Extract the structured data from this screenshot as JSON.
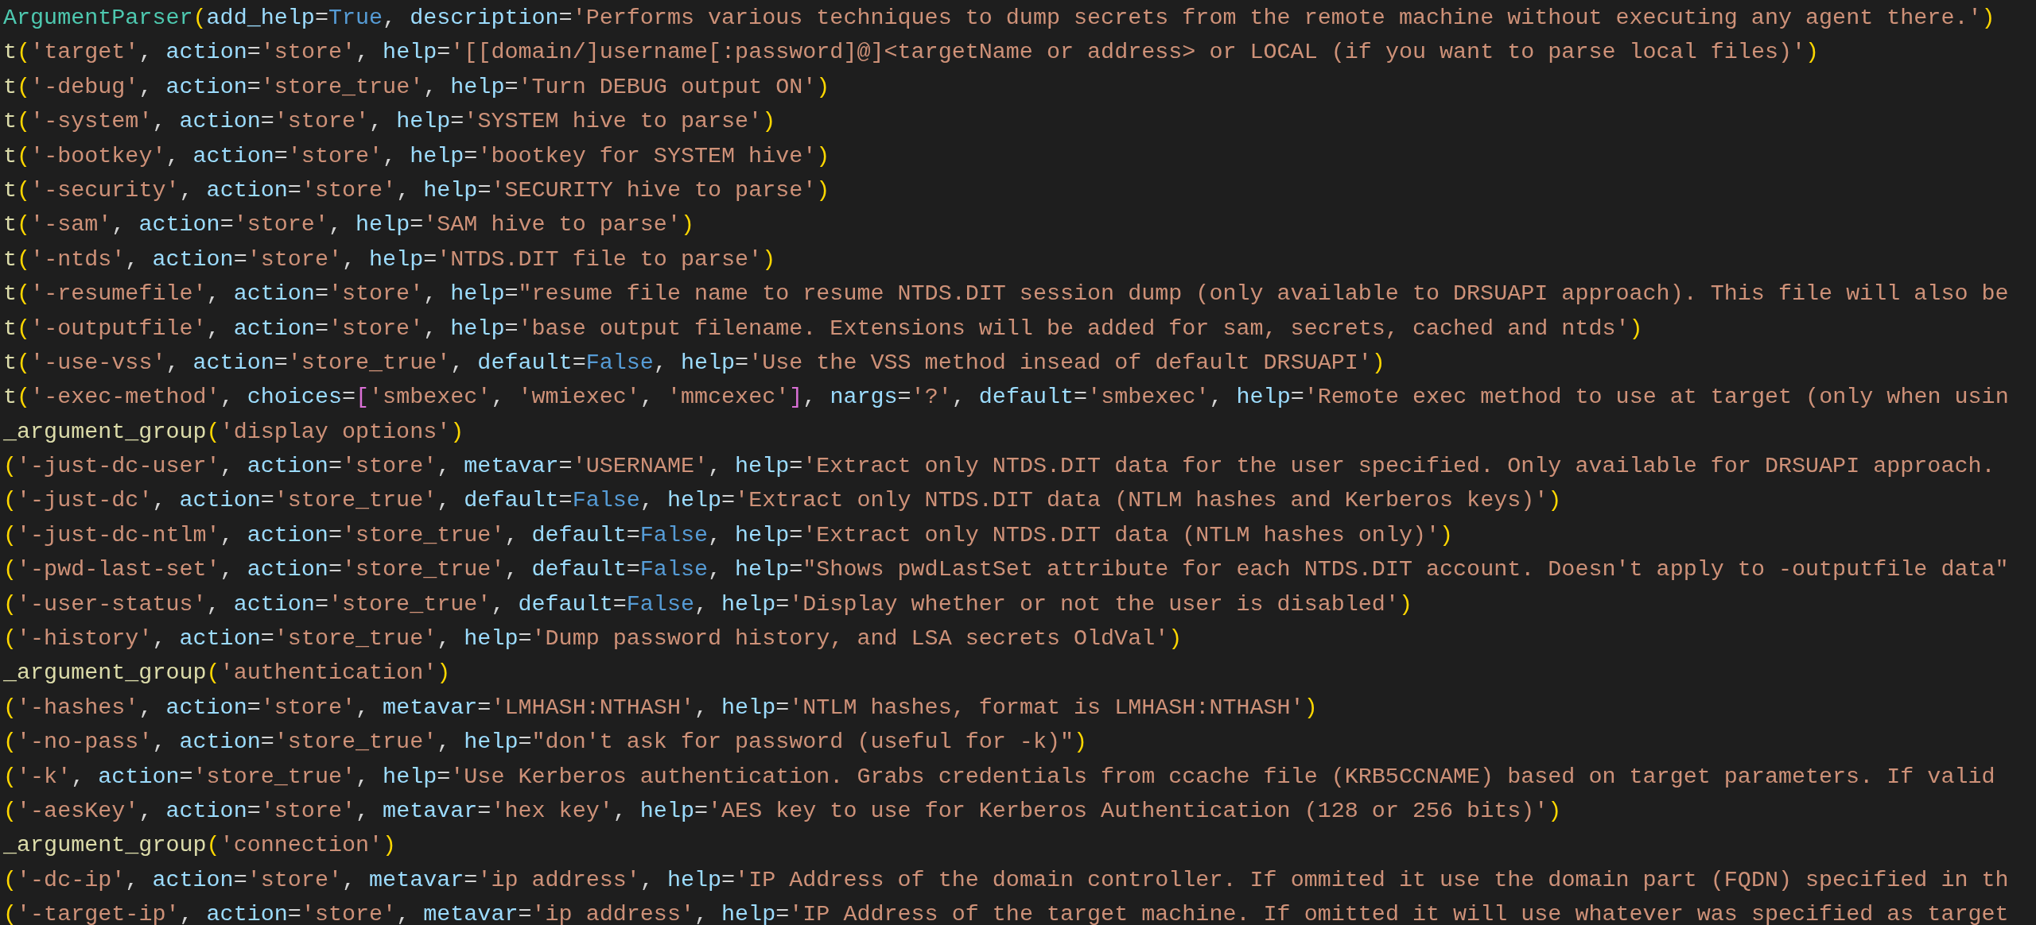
{
  "editor": {
    "lines": [
      {
        "tokens": [
          {
            "kind": "cls",
            "text": "ArgumentParser"
          },
          {
            "kind": "paren",
            "text": "("
          },
          {
            "kind": "arg",
            "text": "add_help"
          },
          {
            "kind": "op",
            "text": "="
          },
          {
            "kind": "kw",
            "text": "True"
          },
          {
            "kind": "op",
            "text": ", "
          },
          {
            "kind": "arg",
            "text": "description"
          },
          {
            "kind": "op",
            "text": "="
          },
          {
            "kind": "str",
            "text": "'Performs various techniques to dump secrets from the remote machine without executing any agent there.'"
          },
          {
            "kind": "paren",
            "text": ")"
          }
        ]
      },
      {
        "tokens": [
          {
            "kind": "fn",
            "text": "t"
          },
          {
            "kind": "paren",
            "text": "("
          },
          {
            "kind": "str",
            "text": "'target'"
          },
          {
            "kind": "op",
            "text": ", "
          },
          {
            "kind": "arg",
            "text": "action"
          },
          {
            "kind": "op",
            "text": "="
          },
          {
            "kind": "str",
            "text": "'store'"
          },
          {
            "kind": "op",
            "text": ", "
          },
          {
            "kind": "arg",
            "text": "help"
          },
          {
            "kind": "op",
            "text": "="
          },
          {
            "kind": "str",
            "text": "'[[domain/]username[:password]@]<targetName or address> or LOCAL (if you want to parse local files)'"
          },
          {
            "kind": "paren",
            "text": ")"
          }
        ]
      },
      {
        "tokens": [
          {
            "kind": "fn",
            "text": "t"
          },
          {
            "kind": "paren",
            "text": "("
          },
          {
            "kind": "str",
            "text": "'-debug'"
          },
          {
            "kind": "op",
            "text": ", "
          },
          {
            "kind": "arg",
            "text": "action"
          },
          {
            "kind": "op",
            "text": "="
          },
          {
            "kind": "str",
            "text": "'store_true'"
          },
          {
            "kind": "op",
            "text": ", "
          },
          {
            "kind": "arg",
            "text": "help"
          },
          {
            "kind": "op",
            "text": "="
          },
          {
            "kind": "str",
            "text": "'Turn DEBUG output ON'"
          },
          {
            "kind": "paren",
            "text": ")"
          }
        ]
      },
      {
        "tokens": [
          {
            "kind": "fn",
            "text": "t"
          },
          {
            "kind": "paren",
            "text": "("
          },
          {
            "kind": "str",
            "text": "'-system'"
          },
          {
            "kind": "op",
            "text": ", "
          },
          {
            "kind": "arg",
            "text": "action"
          },
          {
            "kind": "op",
            "text": "="
          },
          {
            "kind": "str",
            "text": "'store'"
          },
          {
            "kind": "op",
            "text": ", "
          },
          {
            "kind": "arg",
            "text": "help"
          },
          {
            "kind": "op",
            "text": "="
          },
          {
            "kind": "str",
            "text": "'SYSTEM hive to parse'"
          },
          {
            "kind": "paren",
            "text": ")"
          }
        ]
      },
      {
        "tokens": [
          {
            "kind": "fn",
            "text": "t"
          },
          {
            "kind": "paren",
            "text": "("
          },
          {
            "kind": "str",
            "text": "'-bootkey'"
          },
          {
            "kind": "op",
            "text": ", "
          },
          {
            "kind": "arg",
            "text": "action"
          },
          {
            "kind": "op",
            "text": "="
          },
          {
            "kind": "str",
            "text": "'store'"
          },
          {
            "kind": "op",
            "text": ", "
          },
          {
            "kind": "arg",
            "text": "help"
          },
          {
            "kind": "op",
            "text": "="
          },
          {
            "kind": "str",
            "text": "'bootkey for SYSTEM hive'"
          },
          {
            "kind": "paren",
            "text": ")"
          }
        ]
      },
      {
        "tokens": [
          {
            "kind": "fn",
            "text": "t"
          },
          {
            "kind": "paren",
            "text": "("
          },
          {
            "kind": "str",
            "text": "'-security'"
          },
          {
            "kind": "op",
            "text": ", "
          },
          {
            "kind": "arg",
            "text": "action"
          },
          {
            "kind": "op",
            "text": "="
          },
          {
            "kind": "str",
            "text": "'store'"
          },
          {
            "kind": "op",
            "text": ", "
          },
          {
            "kind": "arg",
            "text": "help"
          },
          {
            "kind": "op",
            "text": "="
          },
          {
            "kind": "str",
            "text": "'SECURITY hive to parse'"
          },
          {
            "kind": "paren",
            "text": ")"
          }
        ]
      },
      {
        "tokens": [
          {
            "kind": "fn",
            "text": "t"
          },
          {
            "kind": "paren",
            "text": "("
          },
          {
            "kind": "str",
            "text": "'-sam'"
          },
          {
            "kind": "op",
            "text": ", "
          },
          {
            "kind": "arg",
            "text": "action"
          },
          {
            "kind": "op",
            "text": "="
          },
          {
            "kind": "str",
            "text": "'store'"
          },
          {
            "kind": "op",
            "text": ", "
          },
          {
            "kind": "arg",
            "text": "help"
          },
          {
            "kind": "op",
            "text": "="
          },
          {
            "kind": "str",
            "text": "'SAM hive to parse'"
          },
          {
            "kind": "paren",
            "text": ")"
          }
        ]
      },
      {
        "tokens": [
          {
            "kind": "fn",
            "text": "t"
          },
          {
            "kind": "paren",
            "text": "("
          },
          {
            "kind": "str",
            "text": "'-ntds'"
          },
          {
            "kind": "op",
            "text": ", "
          },
          {
            "kind": "arg",
            "text": "action"
          },
          {
            "kind": "op",
            "text": "="
          },
          {
            "kind": "str",
            "text": "'store'"
          },
          {
            "kind": "op",
            "text": ", "
          },
          {
            "kind": "arg",
            "text": "help"
          },
          {
            "kind": "op",
            "text": "="
          },
          {
            "kind": "str",
            "text": "'NTDS.DIT file to parse'"
          },
          {
            "kind": "paren",
            "text": ")"
          }
        ]
      },
      {
        "tokens": [
          {
            "kind": "fn",
            "text": "t"
          },
          {
            "kind": "paren",
            "text": "("
          },
          {
            "kind": "str",
            "text": "'-resumefile'"
          },
          {
            "kind": "op",
            "text": ", "
          },
          {
            "kind": "arg",
            "text": "action"
          },
          {
            "kind": "op",
            "text": "="
          },
          {
            "kind": "str",
            "text": "'store'"
          },
          {
            "kind": "op",
            "text": ", "
          },
          {
            "kind": "arg",
            "text": "help"
          },
          {
            "kind": "op",
            "text": "="
          },
          {
            "kind": "str",
            "text": "\"resume file name to resume NTDS.DIT session dump (only available to DRSUAPI approach). This file will also be"
          }
        ]
      },
      {
        "tokens": [
          {
            "kind": "fn",
            "text": "t"
          },
          {
            "kind": "paren",
            "text": "("
          },
          {
            "kind": "str",
            "text": "'-outputfile'"
          },
          {
            "kind": "op",
            "text": ", "
          },
          {
            "kind": "arg",
            "text": "action"
          },
          {
            "kind": "op",
            "text": "="
          },
          {
            "kind": "str",
            "text": "'store'"
          },
          {
            "kind": "op",
            "text": ", "
          },
          {
            "kind": "arg",
            "text": "help"
          },
          {
            "kind": "op",
            "text": "="
          },
          {
            "kind": "str",
            "text": "'base output filename. Extensions will be added for sam, secrets, cached and ntds'"
          },
          {
            "kind": "paren",
            "text": ")"
          }
        ]
      },
      {
        "tokens": [
          {
            "kind": "fn",
            "text": "t"
          },
          {
            "kind": "paren",
            "text": "("
          },
          {
            "kind": "str",
            "text": "'-use-vss'"
          },
          {
            "kind": "op",
            "text": ", "
          },
          {
            "kind": "arg",
            "text": "action"
          },
          {
            "kind": "op",
            "text": "="
          },
          {
            "kind": "str",
            "text": "'store_true'"
          },
          {
            "kind": "op",
            "text": ", "
          },
          {
            "kind": "arg",
            "text": "default"
          },
          {
            "kind": "op",
            "text": "="
          },
          {
            "kind": "kw",
            "text": "False"
          },
          {
            "kind": "op",
            "text": ", "
          },
          {
            "kind": "arg",
            "text": "help"
          },
          {
            "kind": "op",
            "text": "="
          },
          {
            "kind": "str",
            "text": "'Use the VSS method insead of default DRSUAPI'"
          },
          {
            "kind": "paren",
            "text": ")"
          }
        ]
      },
      {
        "tokens": [
          {
            "kind": "fn",
            "text": "t"
          },
          {
            "kind": "paren",
            "text": "("
          },
          {
            "kind": "str",
            "text": "'-exec-method'"
          },
          {
            "kind": "op",
            "text": ", "
          },
          {
            "kind": "arg",
            "text": "choices"
          },
          {
            "kind": "op",
            "text": "="
          },
          {
            "kind": "brk",
            "text": "["
          },
          {
            "kind": "str",
            "text": "'smbexec'"
          },
          {
            "kind": "op",
            "text": ", "
          },
          {
            "kind": "str",
            "text": "'wmiexec'"
          },
          {
            "kind": "op",
            "text": ", "
          },
          {
            "kind": "str",
            "text": "'mmcexec'"
          },
          {
            "kind": "brk",
            "text": "]"
          },
          {
            "kind": "op",
            "text": ", "
          },
          {
            "kind": "arg",
            "text": "nargs"
          },
          {
            "kind": "op",
            "text": "="
          },
          {
            "kind": "str",
            "text": "'?'"
          },
          {
            "kind": "op",
            "text": ", "
          },
          {
            "kind": "arg",
            "text": "default"
          },
          {
            "kind": "op",
            "text": "="
          },
          {
            "kind": "str",
            "text": "'smbexec'"
          },
          {
            "kind": "op",
            "text": ", "
          },
          {
            "kind": "arg",
            "text": "help"
          },
          {
            "kind": "op",
            "text": "="
          },
          {
            "kind": "str",
            "text": "'Remote exec method to use at target (only when usin"
          }
        ]
      },
      {
        "tokens": [
          {
            "kind": "fn",
            "text": "_argument_group"
          },
          {
            "kind": "paren",
            "text": "("
          },
          {
            "kind": "str",
            "text": "'display options'"
          },
          {
            "kind": "paren",
            "text": ")"
          }
        ]
      },
      {
        "tokens": [
          {
            "kind": "paren",
            "text": "("
          },
          {
            "kind": "str",
            "text": "'-just-dc-user'"
          },
          {
            "kind": "op",
            "text": ", "
          },
          {
            "kind": "arg",
            "text": "action"
          },
          {
            "kind": "op",
            "text": "="
          },
          {
            "kind": "str",
            "text": "'store'"
          },
          {
            "kind": "op",
            "text": ", "
          },
          {
            "kind": "arg",
            "text": "metavar"
          },
          {
            "kind": "op",
            "text": "="
          },
          {
            "kind": "str",
            "text": "'USERNAME'"
          },
          {
            "kind": "op",
            "text": ", "
          },
          {
            "kind": "arg",
            "text": "help"
          },
          {
            "kind": "op",
            "text": "="
          },
          {
            "kind": "str",
            "text": "'Extract only NTDS.DIT data for the user specified. Only available for DRSUAPI approach."
          }
        ]
      },
      {
        "tokens": [
          {
            "kind": "paren",
            "text": "("
          },
          {
            "kind": "str",
            "text": "'-just-dc'"
          },
          {
            "kind": "op",
            "text": ", "
          },
          {
            "kind": "arg",
            "text": "action"
          },
          {
            "kind": "op",
            "text": "="
          },
          {
            "kind": "str",
            "text": "'store_true'"
          },
          {
            "kind": "op",
            "text": ", "
          },
          {
            "kind": "arg",
            "text": "default"
          },
          {
            "kind": "op",
            "text": "="
          },
          {
            "kind": "kw",
            "text": "False"
          },
          {
            "kind": "op",
            "text": ", "
          },
          {
            "kind": "arg",
            "text": "help"
          },
          {
            "kind": "op",
            "text": "="
          },
          {
            "kind": "str",
            "text": "'Extract only NTDS.DIT data (NTLM hashes and Kerberos keys)'"
          },
          {
            "kind": "paren",
            "text": ")"
          }
        ]
      },
      {
        "tokens": [
          {
            "kind": "paren",
            "text": "("
          },
          {
            "kind": "str",
            "text": "'-just-dc-ntlm'"
          },
          {
            "kind": "op",
            "text": ", "
          },
          {
            "kind": "arg",
            "text": "action"
          },
          {
            "kind": "op",
            "text": "="
          },
          {
            "kind": "str",
            "text": "'store_true'"
          },
          {
            "kind": "op",
            "text": ", "
          },
          {
            "kind": "arg",
            "text": "default"
          },
          {
            "kind": "op",
            "text": "="
          },
          {
            "kind": "kw",
            "text": "False"
          },
          {
            "kind": "op",
            "text": ", "
          },
          {
            "kind": "arg",
            "text": "help"
          },
          {
            "kind": "op",
            "text": "="
          },
          {
            "kind": "str",
            "text": "'Extract only NTDS.DIT data (NTLM hashes only)'"
          },
          {
            "kind": "paren",
            "text": ")"
          }
        ]
      },
      {
        "tokens": [
          {
            "kind": "paren",
            "text": "("
          },
          {
            "kind": "str",
            "text": "'-pwd-last-set'"
          },
          {
            "kind": "op",
            "text": ", "
          },
          {
            "kind": "arg",
            "text": "action"
          },
          {
            "kind": "op",
            "text": "="
          },
          {
            "kind": "str",
            "text": "'store_true'"
          },
          {
            "kind": "op",
            "text": ", "
          },
          {
            "kind": "arg",
            "text": "default"
          },
          {
            "kind": "op",
            "text": "="
          },
          {
            "kind": "kw",
            "text": "False"
          },
          {
            "kind": "op",
            "text": ", "
          },
          {
            "kind": "arg",
            "text": "help"
          },
          {
            "kind": "op",
            "text": "="
          },
          {
            "kind": "str",
            "text": "\"Shows pwdLastSet attribute for each NTDS.DIT account. Doesn't apply to -outputfile data\""
          }
        ]
      },
      {
        "tokens": [
          {
            "kind": "paren",
            "text": "("
          },
          {
            "kind": "str",
            "text": "'-user-status'"
          },
          {
            "kind": "op",
            "text": ", "
          },
          {
            "kind": "arg",
            "text": "action"
          },
          {
            "kind": "op",
            "text": "="
          },
          {
            "kind": "str",
            "text": "'store_true'"
          },
          {
            "kind": "op",
            "text": ", "
          },
          {
            "kind": "arg",
            "text": "default"
          },
          {
            "kind": "op",
            "text": "="
          },
          {
            "kind": "kw",
            "text": "False"
          },
          {
            "kind": "op",
            "text": ", "
          },
          {
            "kind": "arg",
            "text": "help"
          },
          {
            "kind": "op",
            "text": "="
          },
          {
            "kind": "str",
            "text": "'Display whether or not the user is disabled'"
          },
          {
            "kind": "paren",
            "text": ")"
          }
        ]
      },
      {
        "tokens": [
          {
            "kind": "paren",
            "text": "("
          },
          {
            "kind": "str",
            "text": "'-history'"
          },
          {
            "kind": "op",
            "text": ", "
          },
          {
            "kind": "arg",
            "text": "action"
          },
          {
            "kind": "op",
            "text": "="
          },
          {
            "kind": "str",
            "text": "'store_true'"
          },
          {
            "kind": "op",
            "text": ", "
          },
          {
            "kind": "arg",
            "text": "help"
          },
          {
            "kind": "op",
            "text": "="
          },
          {
            "kind": "str",
            "text": "'Dump password history, and LSA secrets OldVal'"
          },
          {
            "kind": "paren",
            "text": ")"
          }
        ]
      },
      {
        "tokens": [
          {
            "kind": "fn",
            "text": "_argument_group"
          },
          {
            "kind": "paren",
            "text": "("
          },
          {
            "kind": "str",
            "text": "'authentication'"
          },
          {
            "kind": "paren",
            "text": ")"
          }
        ]
      },
      {
        "tokens": [
          {
            "kind": "paren",
            "text": "("
          },
          {
            "kind": "str",
            "text": "'-hashes'"
          },
          {
            "kind": "op",
            "text": ", "
          },
          {
            "kind": "arg",
            "text": "action"
          },
          {
            "kind": "op",
            "text": "="
          },
          {
            "kind": "str",
            "text": "'store'"
          },
          {
            "kind": "op",
            "text": ", "
          },
          {
            "kind": "arg",
            "text": "metavar"
          },
          {
            "kind": "op",
            "text": "="
          },
          {
            "kind": "str",
            "text": "'LMHASH:NTHASH'"
          },
          {
            "kind": "op",
            "text": ", "
          },
          {
            "kind": "arg",
            "text": "help"
          },
          {
            "kind": "op",
            "text": "="
          },
          {
            "kind": "str",
            "text": "'NTLM hashes, format is LMHASH:NTHASH'"
          },
          {
            "kind": "paren",
            "text": ")"
          }
        ]
      },
      {
        "tokens": [
          {
            "kind": "paren",
            "text": "("
          },
          {
            "kind": "str",
            "text": "'-no-pass'"
          },
          {
            "kind": "op",
            "text": ", "
          },
          {
            "kind": "arg",
            "text": "action"
          },
          {
            "kind": "op",
            "text": "="
          },
          {
            "kind": "str",
            "text": "'store_true'"
          },
          {
            "kind": "op",
            "text": ", "
          },
          {
            "kind": "arg",
            "text": "help"
          },
          {
            "kind": "op",
            "text": "="
          },
          {
            "kind": "str",
            "text": "\"don't ask for password (useful for -k)\""
          },
          {
            "kind": "paren",
            "text": ")"
          }
        ]
      },
      {
        "tokens": [
          {
            "kind": "paren",
            "text": "("
          },
          {
            "kind": "str",
            "text": "'-k'"
          },
          {
            "kind": "op",
            "text": ", "
          },
          {
            "kind": "arg",
            "text": "action"
          },
          {
            "kind": "op",
            "text": "="
          },
          {
            "kind": "str",
            "text": "'store_true'"
          },
          {
            "kind": "op",
            "text": ", "
          },
          {
            "kind": "arg",
            "text": "help"
          },
          {
            "kind": "op",
            "text": "="
          },
          {
            "kind": "str",
            "text": "'Use Kerberos authentication. Grabs credentials from ccache file (KRB5CCNAME) based on target parameters. If valid"
          }
        ]
      },
      {
        "tokens": [
          {
            "kind": "paren",
            "text": "("
          },
          {
            "kind": "str",
            "text": "'-aesKey'"
          },
          {
            "kind": "op",
            "text": ", "
          },
          {
            "kind": "arg",
            "text": "action"
          },
          {
            "kind": "op",
            "text": "="
          },
          {
            "kind": "str",
            "text": "'store'"
          },
          {
            "kind": "op",
            "text": ", "
          },
          {
            "kind": "arg",
            "text": "metavar"
          },
          {
            "kind": "op",
            "text": "="
          },
          {
            "kind": "str",
            "text": "'hex key'"
          },
          {
            "kind": "op",
            "text": ", "
          },
          {
            "kind": "arg",
            "text": "help"
          },
          {
            "kind": "op",
            "text": "="
          },
          {
            "kind": "str",
            "text": "'AES key to use for Kerberos Authentication (128 or 256 bits)'"
          },
          {
            "kind": "paren",
            "text": ")"
          }
        ]
      },
      {
        "tokens": [
          {
            "kind": "fn",
            "text": "_argument_group"
          },
          {
            "kind": "paren",
            "text": "("
          },
          {
            "kind": "str",
            "text": "'connection'"
          },
          {
            "kind": "paren",
            "text": ")"
          }
        ]
      },
      {
        "tokens": [
          {
            "kind": "paren",
            "text": "("
          },
          {
            "kind": "str",
            "text": "'-dc-ip'"
          },
          {
            "kind": "op",
            "text": ", "
          },
          {
            "kind": "arg",
            "text": "action"
          },
          {
            "kind": "op",
            "text": "="
          },
          {
            "kind": "str",
            "text": "'store'"
          },
          {
            "kind": "op",
            "text": ", "
          },
          {
            "kind": "arg",
            "text": "metavar"
          },
          {
            "kind": "op",
            "text": "="
          },
          {
            "kind": "str",
            "text": "'ip address'"
          },
          {
            "kind": "op",
            "text": ", "
          },
          {
            "kind": "arg",
            "text": "help"
          },
          {
            "kind": "op",
            "text": "="
          },
          {
            "kind": "str",
            "text": "'IP Address of the domain controller. If ommited it use the domain part (FQDN) specified in th"
          }
        ]
      },
      {
        "tokens": [
          {
            "kind": "paren",
            "text": "("
          },
          {
            "kind": "str",
            "text": "'-target-ip'"
          },
          {
            "kind": "op",
            "text": ", "
          },
          {
            "kind": "arg",
            "text": "action"
          },
          {
            "kind": "op",
            "text": "="
          },
          {
            "kind": "str",
            "text": "'store'"
          },
          {
            "kind": "op",
            "text": ", "
          },
          {
            "kind": "arg",
            "text": "metavar"
          },
          {
            "kind": "op",
            "text": "="
          },
          {
            "kind": "str",
            "text": "'ip address'"
          },
          {
            "kind": "op",
            "text": ", "
          },
          {
            "kind": "arg",
            "text": "help"
          },
          {
            "kind": "op",
            "text": "="
          },
          {
            "kind": "str",
            "text": "'IP Address of the target machine. If omitted it will use whatever was specified as target"
          }
        ]
      }
    ]
  }
}
